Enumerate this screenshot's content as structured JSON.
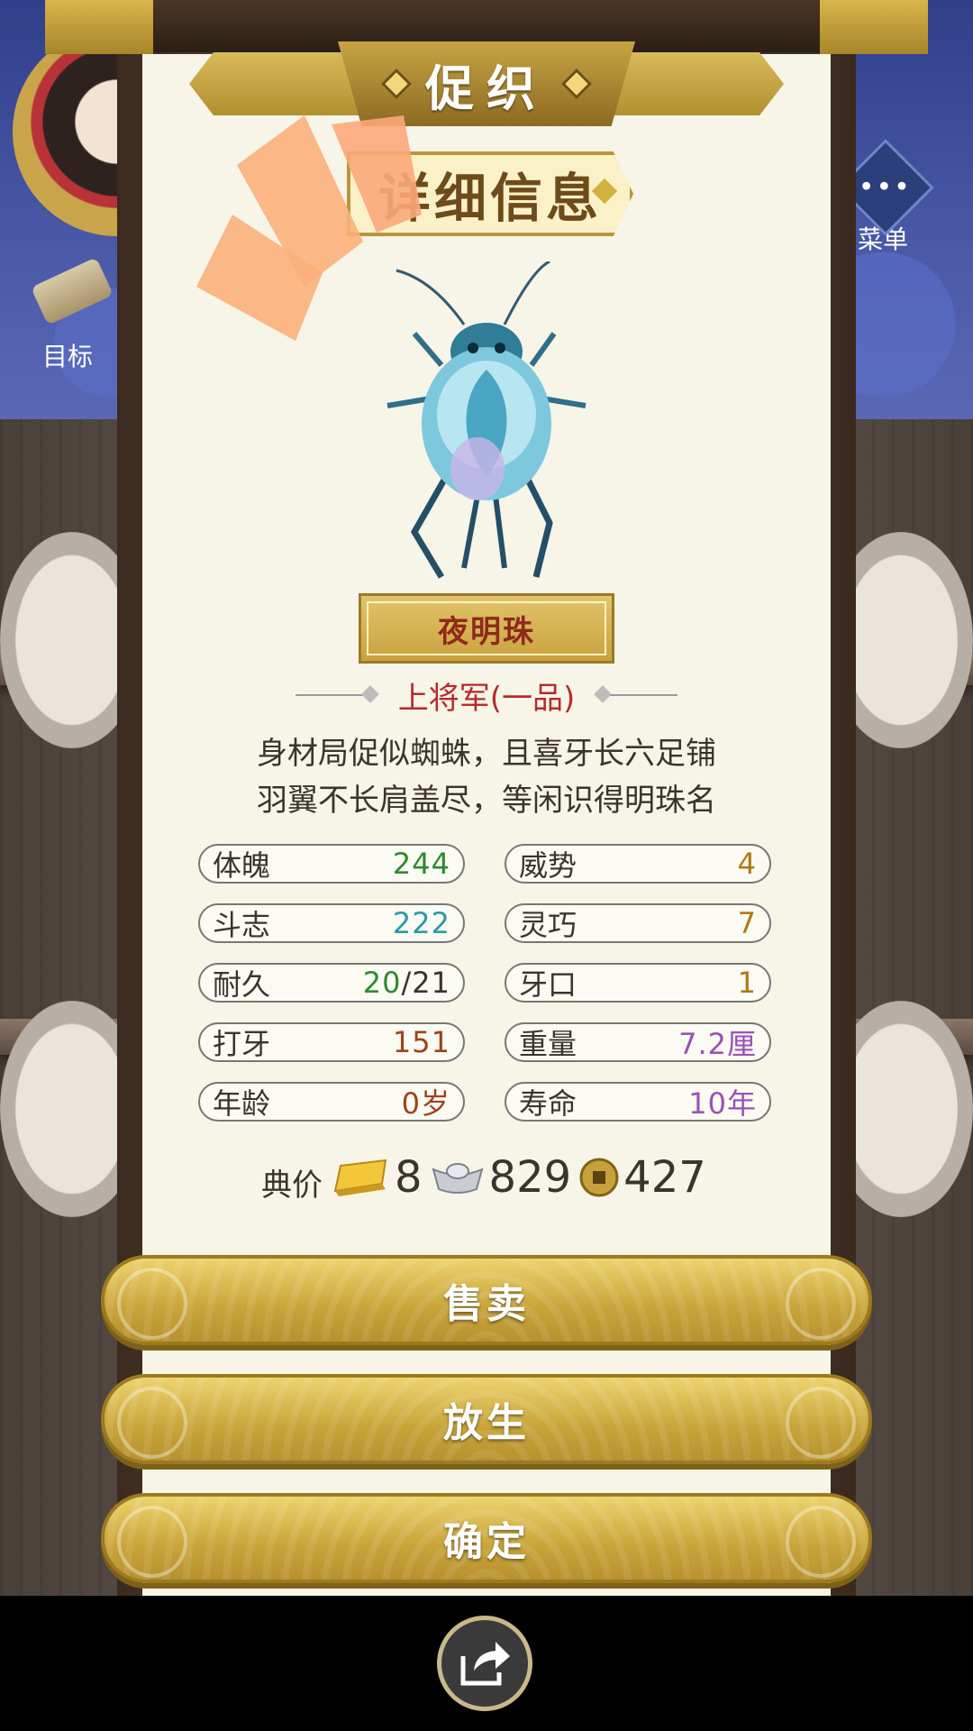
{
  "header": {
    "title": "促织"
  },
  "section": {
    "label": "详细信息"
  },
  "cricket": {
    "name": "夜明珠",
    "rank": "上将军(一品)",
    "poem": [
      "身材局促似蜘蛛，且喜牙长六足铺",
      "羽翼不长肩盖尽，等闲识得明珠名"
    ]
  },
  "stats": [
    {
      "label": "体魄",
      "value": "244",
      "color": "#2f8a2f"
    },
    {
      "label": "威势",
      "value": "4",
      "color": "#b07a12"
    },
    {
      "label": "斗志",
      "value": "222",
      "color": "#2a9aa8"
    },
    {
      "label": "灵巧",
      "value": "7",
      "color": "#b07a12"
    },
    {
      "label": "耐久",
      "value": "20",
      "value_max": "/21",
      "color": "#2f8a2f"
    },
    {
      "label": "牙口",
      "value": "1",
      "color": "#b07a12"
    },
    {
      "label": "打牙",
      "value": "151",
      "color": "#a0421e"
    },
    {
      "label": "重量",
      "value": "7.2厘",
      "color": "#9a52b8"
    },
    {
      "label": "年龄",
      "value": "0岁",
      "color": "#a0421e"
    },
    {
      "label": "寿命",
      "value": "10年",
      "color": "#9a52b8"
    }
  ],
  "price": {
    "label": "典价",
    "gold": "8",
    "silver": "829",
    "coin": "427"
  },
  "actions": {
    "sell": "售卖",
    "release": "放生",
    "confirm": "确定"
  },
  "side": {
    "menu_label": "菜单",
    "goal_label": "目标"
  },
  "icons": [
    "gold-bar-icon",
    "silver-ingot-icon",
    "copper-coin-icon",
    "share-icon",
    "menu-icon",
    "scroll-icon"
  ]
}
